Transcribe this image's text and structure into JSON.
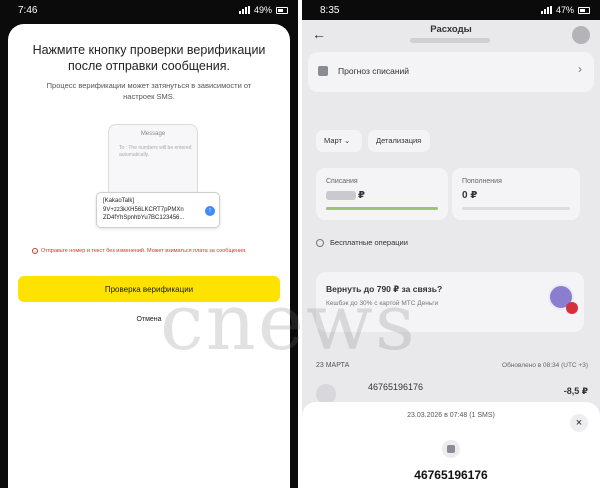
{
  "phone1": {
    "status": {
      "time": "7:46",
      "battery": "49%"
    },
    "title": "Нажмите кнопку проверки верификации после отправки сообщения.",
    "subtitle": "Процесс верификации может затянуться в зависимости от настроек SMS.",
    "illustration": {
      "header": "Message",
      "to_line": "To : The numbers will be entered automatically.",
      "code_lines": [
        "[KakaoTalk]",
        "9V+zz3kXH56LKCRT7pPMXn",
        "ZD4fYhSpnhbYu7BC123456..."
      ]
    },
    "warning": "Отправьте номер и текст без изменений. Может взиматься плата за сообщения.",
    "verify_label": "Проверка верификации",
    "cancel_label": "Отмена"
  },
  "phone2": {
    "status": {
      "time": "8:35",
      "battery": "47%"
    },
    "title": "Расходы",
    "forecast_label": "Прогноз списаний",
    "month_label": "Март",
    "detail_label": "Детализация",
    "spend": {
      "label": "Списания",
      "currency": "₽",
      "progress": 1.0
    },
    "topup": {
      "label": "Пополнения",
      "value": "0 ₽",
      "progress": 0
    },
    "free_ops_label": "Бесплатные операции",
    "promo": {
      "title": "Вернуть до 790 ₽ за связь?",
      "subtitle": "Кешбэк до 30% с картой МТС Деньги"
    },
    "section_date": "23 МАРТА",
    "updated": "Обновлено в 08:34 (UTC +3)",
    "transaction": {
      "number": "46765196176",
      "amount": "-8,5 ₽"
    },
    "sheet": {
      "datetime": "23.03.2026 в 07:48 (1 SMS)",
      "number": "46765196176"
    }
  },
  "watermark": "cnews",
  "colors": {
    "accent_yellow": "#ffe200",
    "warning_red": "#d0382b",
    "progress_green": "#9fc27a"
  }
}
